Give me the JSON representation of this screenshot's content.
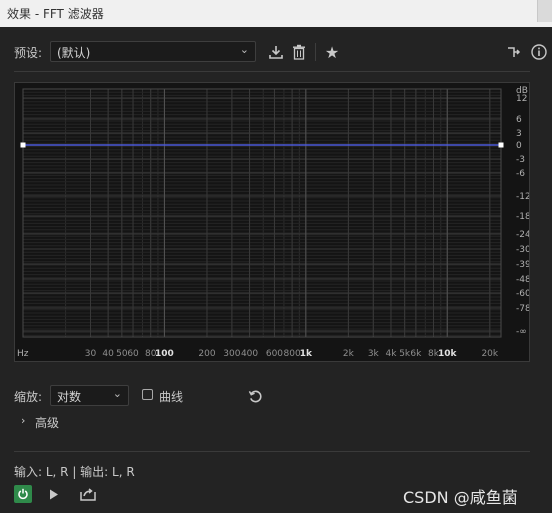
{
  "window": {
    "title": "效果 - FFT 滤波器"
  },
  "preset": {
    "label": "预设:",
    "value": "(默认)"
  },
  "graph": {
    "db_unit": "dB",
    "db_ticks": [
      {
        "label": "12",
        "db": 12
      },
      {
        "label": "6",
        "db": 6
      },
      {
        "label": "3",
        "db": 3
      },
      {
        "label": "0",
        "db": 0
      },
      {
        "label": "-3",
        "db": -3
      },
      {
        "label": "-6",
        "db": -6
      },
      {
        "label": "-12",
        "db": -12
      },
      {
        "label": "-18",
        "db": -18
      },
      {
        "label": "-24",
        "db": -24
      },
      {
        "label": "-30",
        "db": -30
      },
      {
        "label": "-39",
        "db": -39
      },
      {
        "label": "-48",
        "db": -48
      },
      {
        "label": "-60",
        "db": -60
      },
      {
        "label": "-78",
        "db": -78
      },
      {
        "label": "-∞",
        "db": -999
      }
    ],
    "freq_unit": "Hz",
    "freq_ticks": [
      {
        "label": "30",
        "hz": 30,
        "bold": false
      },
      {
        "label": "40",
        "hz": 40,
        "bold": false
      },
      {
        "label": "50",
        "hz": 50,
        "bold": false
      },
      {
        "label": "60",
        "hz": 60,
        "bold": false
      },
      {
        "label": "80",
        "hz": 80,
        "bold": false
      },
      {
        "label": "100",
        "hz": 100,
        "bold": true
      },
      {
        "label": "200",
        "hz": 200,
        "bold": false
      },
      {
        "label": "300",
        "hz": 300,
        "bold": false
      },
      {
        "label": "400",
        "hz": 400,
        "bold": false
      },
      {
        "label": "600",
        "hz": 600,
        "bold": false
      },
      {
        "label": "800",
        "hz": 800,
        "bold": false
      },
      {
        "label": "1k",
        "hz": 1000,
        "bold": true
      },
      {
        "label": "2k",
        "hz": 2000,
        "bold": false
      },
      {
        "label": "3k",
        "hz": 3000,
        "bold": false
      },
      {
        "label": "4k",
        "hz": 4000,
        "bold": false
      },
      {
        "label": "5k",
        "hz": 5000,
        "bold": false
      },
      {
        "label": "6k",
        "hz": 6000,
        "bold": false
      },
      {
        "label": "8k",
        "hz": 8000,
        "bold": false
      },
      {
        "label": "10k",
        "hz": 10000,
        "bold": true
      },
      {
        "label": "20k",
        "hz": 20000,
        "bold": false
      }
    ],
    "curve": {
      "points": [
        {
          "hz": 10,
          "db": 0
        },
        {
          "hz": 24000,
          "db": 0
        }
      ],
      "color": "#4c5ad8"
    }
  },
  "scale": {
    "label": "缩放:",
    "value": "对数"
  },
  "curve_toggle": {
    "label": "曲线",
    "checked": false
  },
  "advanced": {
    "label": "高级"
  },
  "io": {
    "text": "输入: L, R | 输出: L, R"
  },
  "colors": {
    "power_on": "#2f8a4a",
    "background": "#232323",
    "curve": "#4c5ad8"
  },
  "icons": {
    "save_preset": "download-icon",
    "delete_preset": "trash-icon",
    "favorite": "star-icon",
    "routing": "routing-icon",
    "info": "info-icon",
    "reset": "reset-icon",
    "power": "power-icon",
    "play": "play-icon",
    "export": "export-icon"
  },
  "watermark": "CSDN @咸鱼菌"
}
